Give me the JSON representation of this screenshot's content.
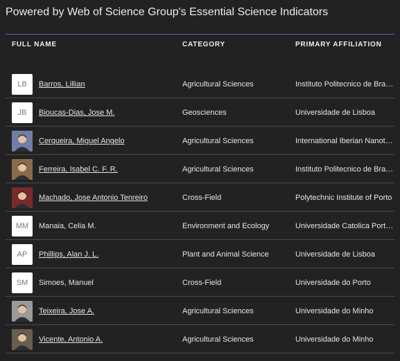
{
  "title": "Powered by Web of Science Group's Essential Science Indicators",
  "headers": {
    "name": "FULL NAME",
    "category": "CATEGORY",
    "affiliation": "PRIMARY AFFILIATION"
  },
  "rows": [
    {
      "initials": "LB",
      "photo": false,
      "name": "Barros, Lillian",
      "link": true,
      "category": "Agricultural Sciences",
      "affiliation": "Instituto Politecnico de Braganca"
    },
    {
      "initials": "JB",
      "photo": false,
      "name": "Bioucas-Dias, Jose M.",
      "link": true,
      "category": "Geosciences",
      "affiliation": "Universidade de Lisboa"
    },
    {
      "initials": "",
      "photo": true,
      "photo_bg": "#6f7fa8",
      "name": "Cerqueira, Miguel Angelo",
      "link": true,
      "category": "Agricultural Sciences",
      "affiliation": "International Iberian Nanotechnology Laboratory"
    },
    {
      "initials": "",
      "photo": true,
      "photo_bg": "#8a6a4c",
      "name": "Ferreira, Isabel C. F. R.",
      "link": true,
      "category": "Agricultural Sciences",
      "affiliation": "Instituto Politecnico de Braganca"
    },
    {
      "initials": "",
      "photo": true,
      "photo_bg": "#7a2a2a",
      "name": "Machado, Jose Antonio Tenreiro",
      "link": true,
      "category": "Cross-Field",
      "affiliation": "Polytechnic Institute of Porto"
    },
    {
      "initials": "MM",
      "photo": false,
      "name": "Manaia, Celia M.",
      "link": false,
      "category": "Environment and Ecology",
      "affiliation": "Universidade Catolica Portuguesa"
    },
    {
      "initials": "AP",
      "photo": false,
      "name": "Phillips, Alan J. L.",
      "link": true,
      "category": "Plant and Animal Science",
      "affiliation": "Universidade de Lisboa"
    },
    {
      "initials": "SM",
      "photo": false,
      "name": "Simoes, Manuel",
      "link": false,
      "category": "Cross-Field",
      "affiliation": "Universidade do Porto"
    },
    {
      "initials": "",
      "photo": true,
      "photo_bg": "#9a9a9a",
      "name": "Teixeira, Jose A.",
      "link": true,
      "category": "Agricultural Sciences",
      "affiliation": "Universidade do Minho"
    },
    {
      "initials": "",
      "photo": true,
      "photo_bg": "#6a5e4e",
      "name": "Vicente, Antonio A.",
      "link": true,
      "category": "Agricultural Sciences",
      "affiliation": "Universidade do Minho"
    }
  ]
}
